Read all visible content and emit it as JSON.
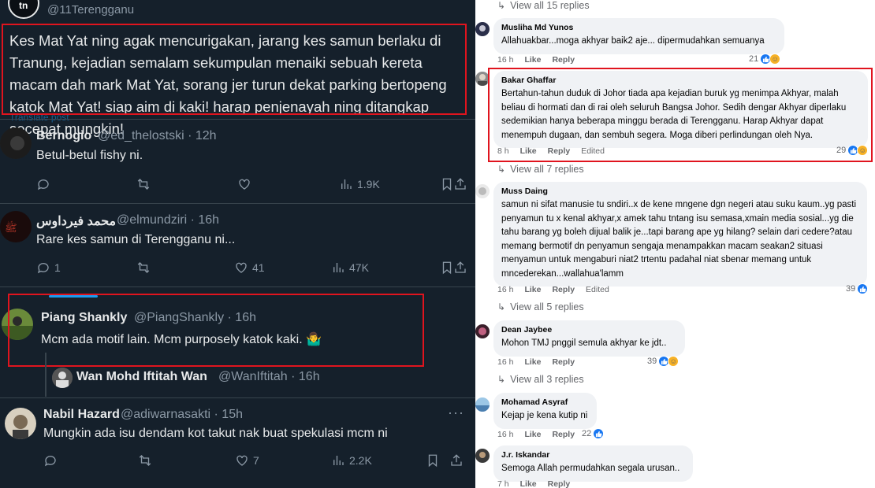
{
  "twitter": {
    "top_handle": "@11Terengganu",
    "main_tweet": "Kes Mat Yat ning agak mencurigakan, jarang kes samun berlaku di Tranung, kejadian semalam sekumpulan menaiki sebuah kereta macam dah mark Mat Yat, sorang jer turun dekat parking bertopeng katok Mat Yat! siap aim di kaki! harap penjenayah ning ditangkap secepat mungkin!",
    "translate": "Translate post",
    "replies": [
      {
        "name": "Bernogio",
        "meta": "@ed_thelostski · 12h",
        "text": "Betul-betul fishy ni.",
        "reply_count": "",
        "retweet_count": "",
        "like_count": "",
        "views": "1.9K"
      },
      {
        "name": "محمد فيرداوس",
        "meta": "@elmundziri · 16h",
        "text": "Rare kes samun di Terengganu ni...",
        "reply_count": "1",
        "retweet_count": "",
        "like_count": "41",
        "views": "47K"
      },
      {
        "name": "Piang Shankly",
        "meta": "@PiangShankly · 16h",
        "text": "Mcm ada motif lain. Mcm purposely katok kaki. 🤷‍♂️"
      },
      {
        "name": "Wan Mohd Iftitah Wan",
        "meta": "@WanIftitah · 16h"
      },
      {
        "name": "Nabil Hazard",
        "meta": "@adiwarnasakti · 15h",
        "text": "Mungkin ada isu dendam kot takut nak buat spekulasi mcm ni",
        "reply_count": "",
        "retweet_count": "",
        "like_count": "7",
        "views": "2.2K"
      }
    ]
  },
  "facebook": {
    "view_replies": [
      "View all 15 replies",
      "View all 7 replies",
      "View all 5 replies",
      "View all 3 replies"
    ],
    "comments": [
      {
        "name": "Musliha Md Yunos",
        "text": "Allahuakbar...moga akhyar baik2 aje... dipermudahkan semuanya",
        "time": "16 h",
        "like": "Like",
        "reply": "Reply",
        "edited": "",
        "reactions": "21"
      },
      {
        "name": "Bakar Ghaffar",
        "text": "Bertahun-tahun duduk di Johor tiada apa kejadian buruk yg menimpa Akhyar, malah beliau di hormati dan di rai oleh seluruh Bangsa Johor. Sedih dengar Akhyar diperlaku sedemikian hanya beberapa minggu berada di Terengganu. Harap Akhyar dapat menempuh dugaan, dan sembuh segera. Moga diberi perlindungan oleh Nya.",
        "time": "8 h",
        "like": "Like",
        "reply": "Reply",
        "edited": "Edited",
        "reactions": "29"
      },
      {
        "name": "Muss Daing",
        "text": "samun ni sifat manusie tu sndiri..x de kene mngene dgn negeri atau suku kaum..yg pasti penyamun tu x kenal akhyar,x amek tahu tntang isu semasa,xmain media sosial...yg die tahu barang yg boleh dijual balik je...tapi barang ape yg hilang? selain dari cedere?atau memang bermotif dn penyamun sengaja menampakkan macam seakan2 situasi menyamun untuk mengaburi niat2 trtentu padahal niat sbenar memang untuk mncederekan...wallahua'lamm",
        "time": "16 h",
        "like": "Like",
        "reply": "Reply",
        "edited": "Edited",
        "reactions": "39"
      },
      {
        "name": "Dean Jaybee",
        "text": "Mohon TMJ pnggil semula akhyar ke jdt..",
        "time": "16 h",
        "like": "Like",
        "reply": "Reply",
        "edited": "",
        "reactions": "39"
      },
      {
        "name": "Mohamad Asyraf",
        "text": "Kejap je kena kutip ni",
        "time": "16 h",
        "like": "Like",
        "reply": "Reply",
        "edited": "",
        "reactions": "22"
      },
      {
        "name": "J.r. Iskandar",
        "text": "Semoga Allah permudahkan segala urusan..",
        "time": "7 h",
        "like": "Like",
        "reply": "Reply",
        "edited": "",
        "reactions": ""
      }
    ]
  },
  "colors": {
    "twitter_bg": "#15202b",
    "highlight_red": "#e0141e",
    "fb_like_blue": "#1877f2"
  }
}
